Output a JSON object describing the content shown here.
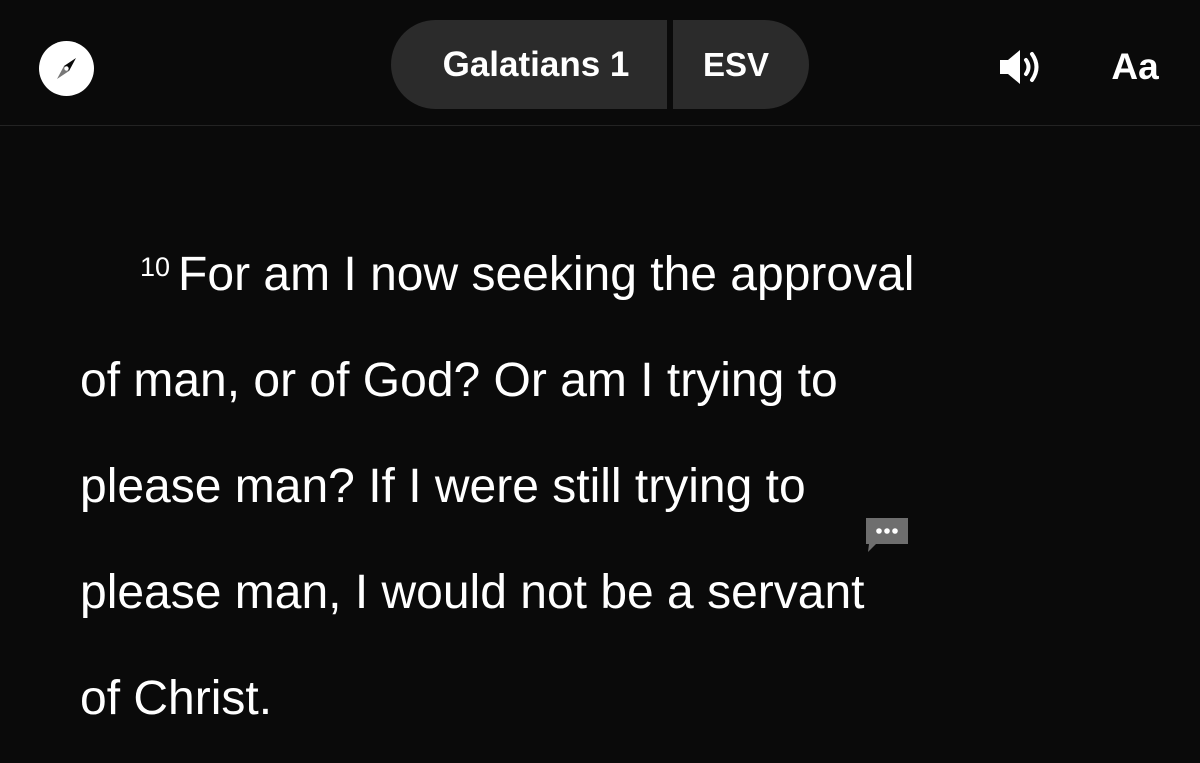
{
  "toolbar": {
    "compass_icon": "compass-icon",
    "book_chapter": "Galatians 1",
    "version": "ESV",
    "audio_icon": "speaker-icon",
    "font_settings_label": "Aa"
  },
  "passage": {
    "verse_number": "10",
    "line1": "For am I now seeking the approval",
    "line2": "of man, or of God? Or am I trying to",
    "line3": "please man? If I were still trying to",
    "line4": "please man, I would not be a servant",
    "line5": "of Christ.",
    "note_icon": "footnote-comment-icon"
  },
  "colors": {
    "background": "#0a0a0a",
    "pill": "#2b2b2b",
    "text": "#ffffff",
    "note_icon": "#6e6e6e"
  }
}
